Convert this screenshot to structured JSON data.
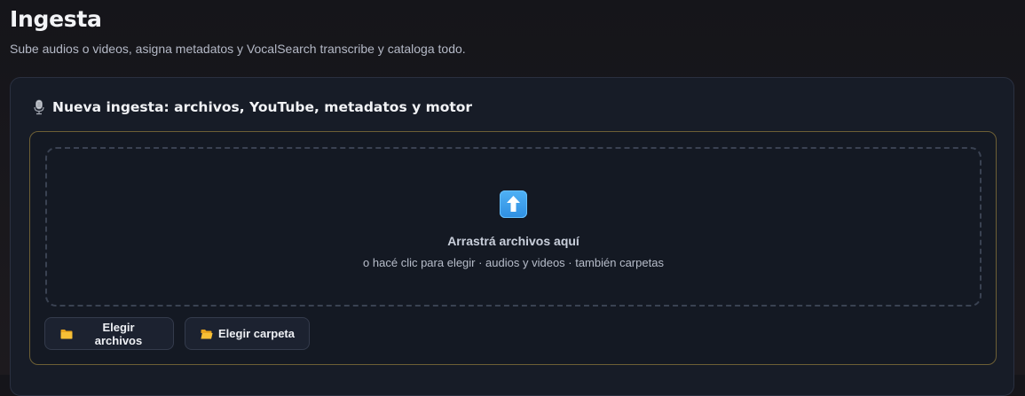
{
  "header": {
    "title": "Ingesta",
    "subtitle": "Sube audios o videos, asigna metadatos y VocalSearch transcribe y cataloga todo."
  },
  "card": {
    "icon": "microphone-icon",
    "title": "Nueva ingesta: archivos, YouTube, metadatos y motor"
  },
  "dropzone": {
    "icon": "upload-arrow-icon",
    "title": "Arrastrá archivos aquí",
    "hint": "o hacé clic para elegir · audios y videos · también carpetas"
  },
  "buttons": {
    "choose_files": {
      "label": "Elegir archivos",
      "icon": "folder-icon"
    },
    "choose_folder": {
      "label": "Elegir carpeta",
      "icon": "open-folder-icon"
    }
  },
  "colors": {
    "accent_border": "#6d5f35",
    "upload_icon": "#3a9de8",
    "folder": "#f2b62a"
  }
}
